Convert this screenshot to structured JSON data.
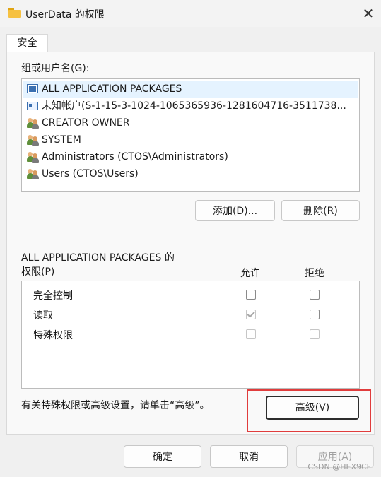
{
  "window": {
    "title": "UserData 的权限",
    "close_glyph": "✕"
  },
  "tabs": [
    {
      "label": "安全"
    }
  ],
  "groups": {
    "label": "组或用户名(G):",
    "items": [
      {
        "icon": "package-icon",
        "name": "ALL APPLICATION PACKAGES",
        "selected": true
      },
      {
        "icon": "unknown-account-icon",
        "name": "未知帐户(S-1-15-3-1024-1065365936-1281604716-3511738..."
      },
      {
        "icon": "users-icon",
        "name": "CREATOR OWNER"
      },
      {
        "icon": "users-icon",
        "name": "SYSTEM"
      },
      {
        "icon": "users-icon",
        "name": "Administrators (CTOS\\Administrators)"
      },
      {
        "icon": "users-icon",
        "name": "Users (CTOS\\Users)"
      }
    ],
    "add_button": "添加(D)...",
    "remove_button": "删除(R)"
  },
  "permissions": {
    "title_line1": "ALL APPLICATION PACKAGES 的",
    "title_line2": "权限(P)",
    "allow_header": "允许",
    "deny_header": "拒绝",
    "rows": [
      {
        "name": "完全控制",
        "allow": "unchecked",
        "deny": "unchecked"
      },
      {
        "name": "读取",
        "allow": "checked-disabled",
        "deny": "unchecked"
      },
      {
        "name": "特殊权限",
        "allow": "disabled",
        "deny": "disabled"
      }
    ]
  },
  "advanced": {
    "note": "有关特殊权限或高级设置，请单击“高级”。",
    "button": "高级(V)",
    "highlight_color": "#e03c3c"
  },
  "footer": {
    "ok_button": "确定",
    "cancel_button": "取消",
    "apply_button": "应用(A)"
  },
  "watermark": "CSDN @HEX9CF"
}
